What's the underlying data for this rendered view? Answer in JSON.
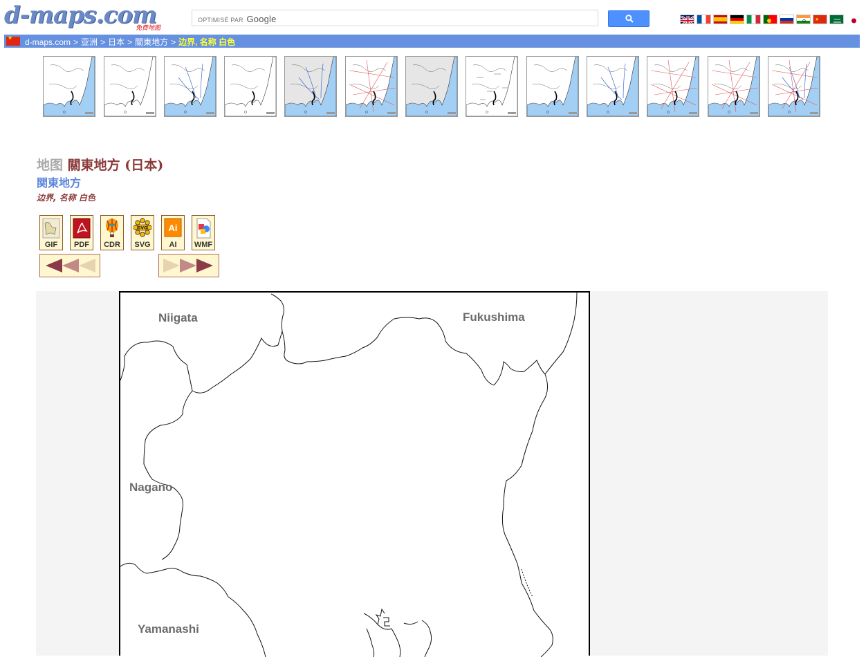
{
  "header": {
    "logo_text": "d-maps.com",
    "logo_tagline": "免费地图",
    "search": {
      "prefix": "OPTIMISÉ PAR",
      "brand": "Google"
    },
    "search_button_icon": "search-icon",
    "languages": [
      "english-flag",
      "french-flag",
      "spanish-flag",
      "german-flag",
      "italian-flag",
      "portuguese-flag",
      "russian-flag",
      "hindi-flag",
      "chinese-flag",
      "arabic-flag",
      "japanese-flag"
    ]
  },
  "breadcrumb": {
    "items": [
      "d-maps.com",
      "亚洲",
      "日本",
      "關東地方"
    ],
    "separator": ">",
    "current": "边界, 名称 白色"
  },
  "thumbnails": [
    "map-variant",
    "map-variant",
    "map-variant",
    "map-variant",
    "map-variant",
    "map-variant",
    "map-variant",
    "map-variant",
    "map-variant",
    "map-variant",
    "map-variant",
    "map-variant",
    "map-variant"
  ],
  "title": {
    "lead": "地图",
    "main": "關東地方 (日本)",
    "subtitle": "関東地方",
    "caption": "边界, 名称 白色"
  },
  "formats": [
    "GIF",
    "PDF",
    "CDR",
    "SVG",
    "AI",
    "WMF"
  ],
  "map": {
    "labels": {
      "niigata": "Niigata",
      "fukushima": "Fukushima",
      "nagano": "Nagano",
      "yamanashi": "Yamanashi"
    }
  },
  "colors": {
    "brand_blue": "#6691e0",
    "title_red": "#8b3a3a",
    "subtitle_blue": "#5b86db",
    "sea_blue": "#a3cff5"
  }
}
